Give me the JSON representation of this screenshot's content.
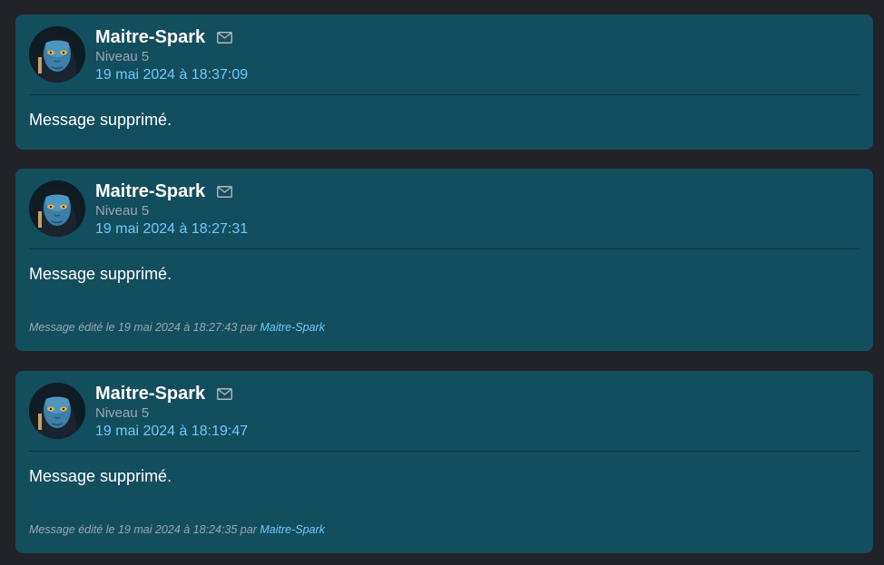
{
  "posts": [
    {
      "author": "Maitre-Spark",
      "level": "Niveau 5",
      "date": "19 mai 2024 à 18:37:09",
      "message": "Message supprimé.",
      "edit_prefix": "",
      "edit_author": ""
    },
    {
      "author": "Maitre-Spark",
      "level": "Niveau 5",
      "date": "19 mai 2024 à 18:27:31",
      "message": "Message supprimé.",
      "edit_prefix": "Message édité le 19 mai 2024 à 18:27:43 par ",
      "edit_author": "Maitre-Spark"
    },
    {
      "author": "Maitre-Spark",
      "level": "Niveau 5",
      "date": "19 mai 2024 à 18:19:47",
      "message": "Message supprimé.",
      "edit_prefix": "Message édité le 19 mai 2024 à 18:24:35 par ",
      "edit_author": "Maitre-Spark"
    }
  ],
  "icons": {
    "mail": "mail-icon",
    "avatar": "avatar-image"
  },
  "colors": {
    "page_bg": "#222328",
    "card_bg": "#134e5e",
    "link": "#6ec8ff",
    "muted": "#9aa7ae"
  }
}
